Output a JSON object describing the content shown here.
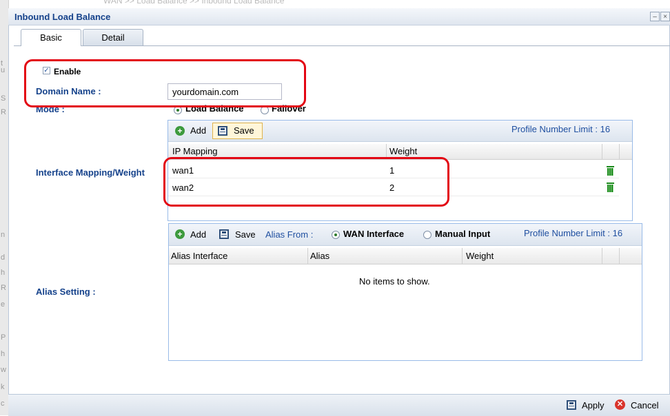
{
  "breadcrumb": "WAN >> Load Balance >> Inbound Load Balance",
  "window": {
    "title": "Inbound Load Balance"
  },
  "left_strip_letters": [
    "t",
    "u",
    "S",
    "R",
    "n",
    "d",
    "h",
    "R",
    "e",
    "P",
    "h",
    "w",
    "k",
    "c"
  ],
  "tabs": [
    {
      "label": "Basic",
      "active": true
    },
    {
      "label": "Detail",
      "active": false
    }
  ],
  "form": {
    "enable_label": "Enable",
    "enable_checked": true,
    "check_mark": "✓",
    "domain_label": "Domain Name :",
    "domain_value": "yourdomain.com",
    "mode_label": "Mode :",
    "mode_options": [
      {
        "label": "Load Balance",
        "selected": true
      },
      {
        "label": "Failover",
        "selected": false
      }
    ],
    "mapping_label": "Interface Mapping/Weight",
    "alias_label": "Alias Setting :"
  },
  "mapping_grid": {
    "add_label": "Add",
    "save_label": "Save",
    "limit_text": "Profile Number Limit : 16",
    "columns": [
      "IP Mapping",
      "Weight"
    ],
    "rows": [
      {
        "interface": "wan1",
        "weight": "1"
      },
      {
        "interface": "wan2",
        "weight": "2"
      }
    ]
  },
  "alias_grid": {
    "add_label": "Add",
    "save_label": "Save",
    "alias_from_label": "Alias From :",
    "alias_from_options": [
      {
        "label": "WAN Interface",
        "selected": true
      },
      {
        "label": "Manual Input",
        "selected": false
      }
    ],
    "limit_text": "Profile Number Limit : 16",
    "columns": [
      "Alias Interface",
      "Alias",
      "Weight"
    ],
    "empty_text": "No items to show."
  },
  "footer": {
    "apply_label": "Apply",
    "cancel_label": "Cancel",
    "cancel_glyph": "✕"
  },
  "window_buttons": {
    "minimize": "–",
    "close": "×"
  },
  "colors": {
    "label_blue": "#15428b",
    "highlight_red": "#e30613",
    "delete_green": "#1c8a1c"
  }
}
